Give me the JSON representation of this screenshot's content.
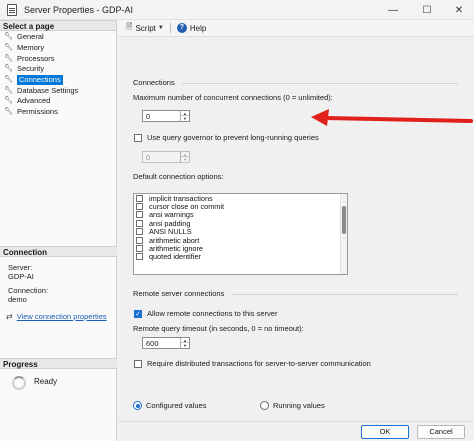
{
  "window": {
    "title": "Server Properties - GDP-AI",
    "minimize": "—",
    "maximize": "☐",
    "close": "✕"
  },
  "sidebar": {
    "header": "Select a page",
    "items": [
      {
        "label": "General",
        "selected": false
      },
      {
        "label": "Memory",
        "selected": false
      },
      {
        "label": "Processors",
        "selected": false
      },
      {
        "label": "Security",
        "selected": false
      },
      {
        "label": "Connections",
        "selected": true
      },
      {
        "label": "Database Settings",
        "selected": false
      },
      {
        "label": "Advanced",
        "selected": false
      },
      {
        "label": "Permissions",
        "selected": false
      }
    ]
  },
  "connection": {
    "header": "Connection",
    "server_label": "Server:",
    "server_value": "GDP-AI",
    "conn_label": "Connection:",
    "conn_value": "demo",
    "view_link": "View connection properties"
  },
  "progress": {
    "header": "Progress",
    "status": "Ready"
  },
  "toolbar": {
    "script_label": "Script",
    "help_label": "Help"
  },
  "connections": {
    "group_title": "Connections",
    "max_conn_label": "Maximum number of concurrent connections (0 = unlimited):",
    "max_conn_value": "0",
    "query_governor_label": "Use query governor to prevent long-running queries",
    "query_governor_checked": false,
    "query_governor_value": "0",
    "default_options_label": "Default connection options:",
    "default_options": [
      {
        "label": "implicit transactions",
        "checked": false
      },
      {
        "label": "cursor close on commit",
        "checked": false
      },
      {
        "label": "ansi warnings",
        "checked": false
      },
      {
        "label": "ansi padding",
        "checked": false
      },
      {
        "label": "ANSI NULLS",
        "checked": false
      },
      {
        "label": "arithmetic abort",
        "checked": false
      },
      {
        "label": "arithmetic ignore",
        "checked": false
      },
      {
        "label": "quoted identifier",
        "checked": false
      }
    ]
  },
  "remote": {
    "group_title": "Remote server connections",
    "allow_label": "Allow remote connections to this server",
    "allow_checked": true,
    "timeout_label": "Remote query timeout (in seconds, 0 = no timeout):",
    "timeout_value": "600",
    "distributed_label": "Require distributed transactions for server-to-server communication",
    "distributed_checked": false
  },
  "values_mode": {
    "configured_label": "Configured values",
    "running_label": "Running values",
    "selected": "configured"
  },
  "buttons": {
    "ok": "OK",
    "cancel": "Cancel"
  },
  "colors": {
    "accent": "#1b6fd2",
    "selection": "#0078d7",
    "annotation_arrow": "#e0201b"
  }
}
